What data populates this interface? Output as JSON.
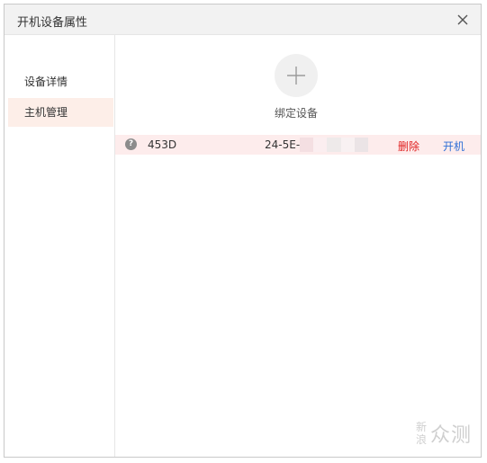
{
  "window": {
    "title": "开机设备属性"
  },
  "icons": {
    "close": "close-icon",
    "add": "plus-icon",
    "status": "question-icon"
  },
  "sidebar": {
    "items": [
      {
        "label": "设备详情",
        "active": false
      },
      {
        "label": "主机管理",
        "active": true
      }
    ]
  },
  "main": {
    "add_label": "绑定设备",
    "devices": [
      {
        "status_symbol": "?",
        "name": "453D",
        "mac_visible": "24-5E-",
        "delete_label": "删除",
        "power_label": "开机"
      }
    ]
  },
  "watermark": {
    "small": [
      "新",
      "浪"
    ],
    "big": "众测"
  },
  "colors": {
    "active_nav_bg": "#fdeee8",
    "device_row_bg": "#fdecec",
    "delete": "#e02020",
    "power": "#2f6fd6"
  }
}
